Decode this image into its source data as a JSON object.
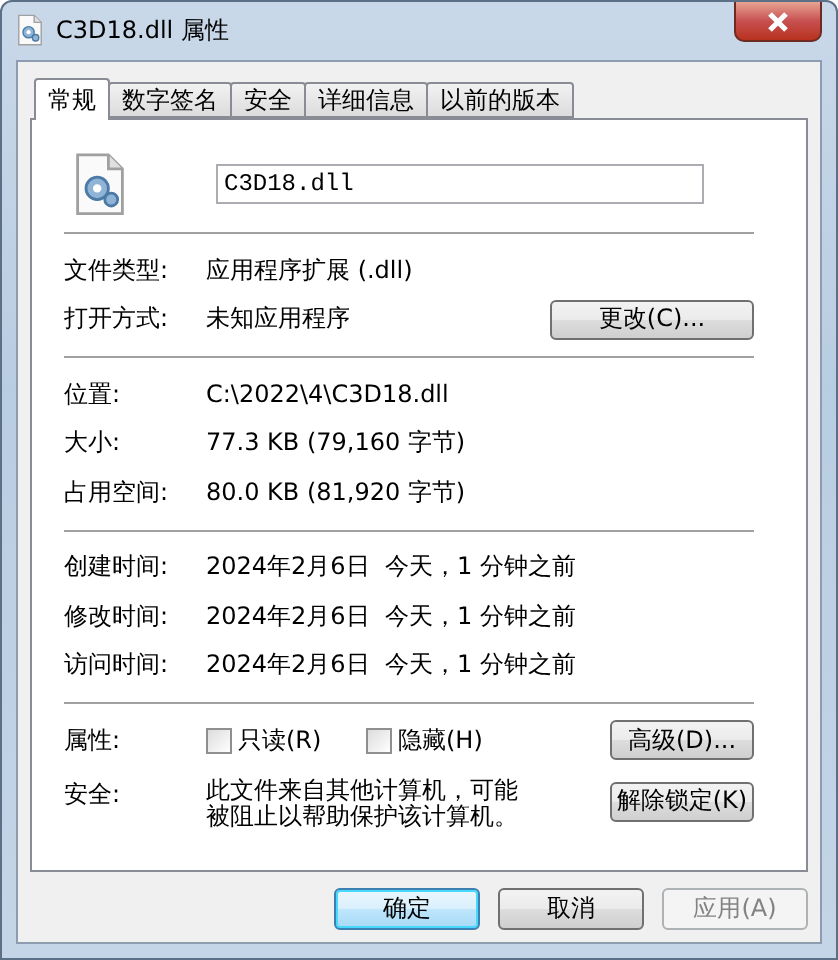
{
  "window": {
    "title": "C3D18.dll 属性"
  },
  "tabs": [
    {
      "label": "常规",
      "selected": true
    },
    {
      "label": "数字签名",
      "selected": false
    },
    {
      "label": "安全",
      "selected": false
    },
    {
      "label": "详细信息",
      "selected": false
    },
    {
      "label": "以前的版本",
      "selected": false
    }
  ],
  "file_name": "C3D18.dll",
  "groups": [
    [
      {
        "label": "文件类型:",
        "value": "应用程序扩展 (.dll)"
      },
      {
        "label": "打开方式:",
        "value": "未知应用程序",
        "button": "更改(C)..."
      }
    ],
    [
      {
        "label": "位置:",
        "value": "C:\\2022\\4\\C3D18.dll"
      },
      {
        "label": "大小:",
        "value": "77.3 KB (79,160 字节)"
      },
      {
        "label": "占用空间:",
        "value": "80.0 KB (81,920 字节)"
      }
    ],
    [
      {
        "label": "创建时间:",
        "value": "2024年2月6日  今天，1 分钟之前"
      },
      {
        "label": "修改时间:",
        "value": "2024年2月6日  今天，1 分钟之前"
      },
      {
        "label": "访问时间:",
        "value": "2024年2月6日  今天，1 分钟之前"
      }
    ]
  ],
  "attributes": {
    "label": "属性:",
    "checkboxes": [
      {
        "label": "只读(R)",
        "checked": false
      },
      {
        "label": "隐藏(H)",
        "checked": false
      }
    ],
    "button": "高级(D)..."
  },
  "security": {
    "label": "安全:",
    "text": "此文件来自其他计算机，可能被阻止以帮助保护该计算机。",
    "button": "解除锁定(K)"
  },
  "buttons": [
    {
      "label": "确定",
      "kind": "default"
    },
    {
      "label": "取消",
      "kind": "normal"
    },
    {
      "label": "应用(A)",
      "kind": "disabled"
    }
  ]
}
